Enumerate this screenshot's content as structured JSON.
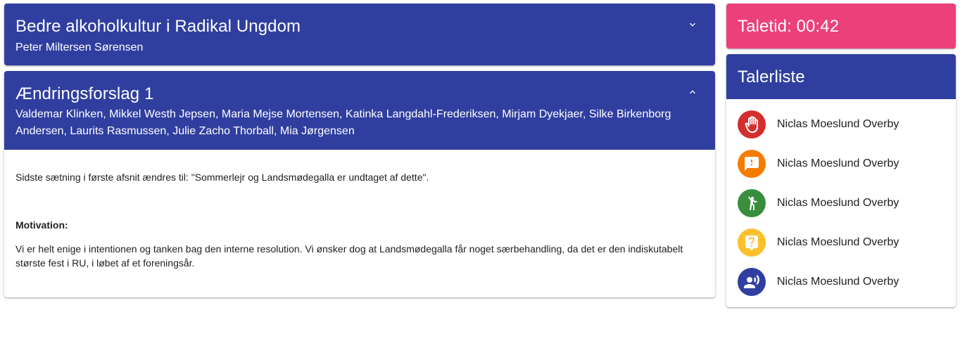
{
  "resolution": {
    "title": "Bedre alkoholkultur i Radikal Ungdom",
    "author": "Peter Miltersen Sørensen",
    "toggle_icon": "chevron-down-icon"
  },
  "amendment": {
    "title": "Ændringsforslag 1",
    "authors": "Valdemar Klinken, Mikkel Westh Jepsen, Maria Mejse Mortensen, Katinka Langdahl-Frederiksen, Mirjam Dyekjaer, Silke Birkenborg Andersen, Laurits Rasmussen, Julie Zacho Thorball, Mia Jørgensen",
    "toggle_icon": "chevron-up-icon",
    "text": "Sidste sætning i første afsnit ændres til: \"Sommerlejr og Landsmødegalla er undtaget af dette\".",
    "motivation_label": "Motivation:",
    "motivation_text": "Vi er helt enige i intentionen og tanken bag den interne resolution. Vi ønsker dog at Landsmødegalla får noget særbehandling, da det er den indiskutabelt største fest i RU, i løbet af et foreningsår."
  },
  "timer": {
    "label": "Taletid: 00:42"
  },
  "speaker_list": {
    "title": "Talerliste",
    "items": [
      {
        "name": "Niclas Moeslund Overby",
        "icon": "hand-icon",
        "color": "#d32f2f"
      },
      {
        "name": "Niclas Moeslund Overby",
        "icon": "exclamation-icon",
        "color": "#f57c00"
      },
      {
        "name": "Niclas Moeslund Overby",
        "icon": "raised-hand-person-icon",
        "color": "#388e3c"
      },
      {
        "name": "Niclas Moeslund Overby",
        "icon": "question-icon",
        "color": "#fbc02d"
      },
      {
        "name": "Niclas Moeslund Overby",
        "icon": "speaking-person-icon",
        "color": "#303f9f"
      }
    ]
  },
  "colors": {
    "primary": "#303f9f",
    "accent": "#ec407a"
  }
}
